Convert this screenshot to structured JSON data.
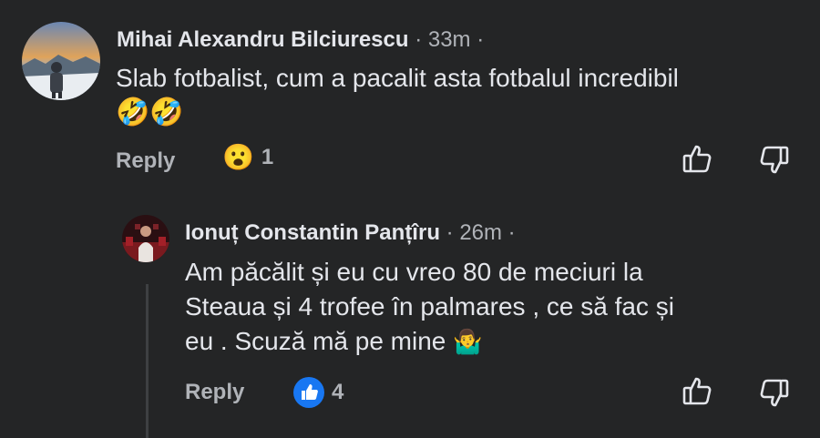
{
  "comment1": {
    "author": "Mihai Alexandru Bilciurescu",
    "time": "· 33m ·",
    "text_line1": "Slab fotbalist, cum a pacalit asta fotbalul incredibil",
    "emojis": "🤣🤣",
    "reply_label": "Reply",
    "reaction_emoji": "😮",
    "reaction_count": "1"
  },
  "comment2": {
    "author": "Ionuț Constantin Panțîru",
    "time": "· 26m ·",
    "text_line1": "Am păcălit și eu cu vreo 80 de meciuri la",
    "text_line2": "Steaua și 4 trofee în palmares , ce să fac și",
    "text_line3": "eu . Scuză mă pe mine",
    "text_emoji": "🤷‍♂️",
    "reply_label": "Reply",
    "reaction_count": "4"
  },
  "icons": {
    "like": "thumbs-up-outline-icon",
    "dislike": "thumbs-down-outline-icon",
    "like_reaction": "like-reaction-icon",
    "wow_reaction": "wow-reaction-icon"
  },
  "colors": {
    "background": "#242526",
    "primary_text": "#e4e6eb",
    "secondary_text": "#b0b3b8",
    "like_blue": "#1877f2"
  }
}
